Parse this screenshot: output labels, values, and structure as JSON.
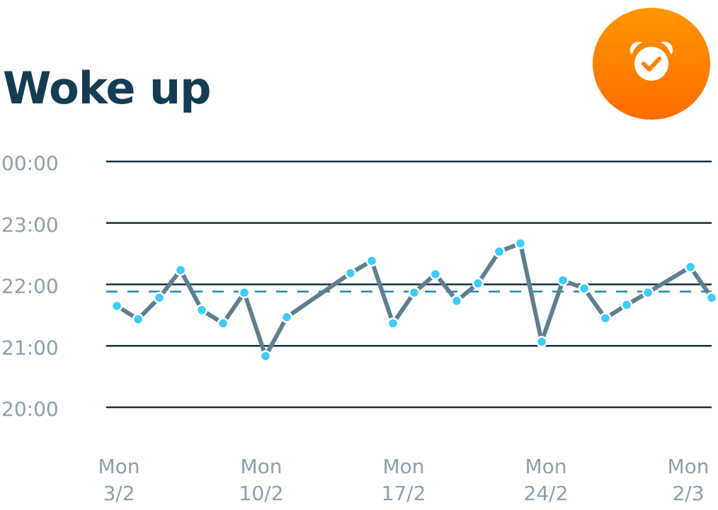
{
  "title": "Woke up",
  "icon": "alarm-clock-check-icon",
  "colors": {
    "title": "#143d52",
    "line": "#5e7f8f",
    "point": "#3ccdfa",
    "average": "#1a8aaf",
    "grid": "#143040",
    "badge_top": "#ff9500",
    "badge_bottom": "#ff6d00"
  },
  "chart_data": {
    "type": "line",
    "title": "Woke up",
    "y_ticks": [
      "00:00",
      "23:00",
      "22:00",
      "21:00",
      "20:00"
    ],
    "ylim": [
      "20:00",
      "24:00"
    ],
    "x_ticks": [
      [
        "Mon",
        "3/2"
      ],
      [
        "Mon",
        "10/2"
      ],
      [
        "Mon",
        "17/2"
      ],
      [
        "Mon",
        "24/2"
      ],
      [
        "Mon",
        "2/3"
      ]
    ],
    "xlim": [
      "3/2",
      "2/3"
    ],
    "grid": true,
    "average": "21:53",
    "points": [
      {
        "x": "3/2",
        "y": "21:39"
      },
      {
        "x": "4/2",
        "y": "21:26"
      },
      {
        "x": "5/2",
        "y": "21:47"
      },
      {
        "x": "6/2",
        "y": "22:14"
      },
      {
        "x": "7/2",
        "y": "21:35"
      },
      {
        "x": "8/2",
        "y": "21:22"
      },
      {
        "x": "9/2",
        "y": "21:52"
      },
      {
        "x": "10/2",
        "y": "20:50"
      },
      {
        "x": "11/2",
        "y": "21:28"
      },
      {
        "x": "14/2",
        "y": "22:11"
      },
      {
        "x": "15/2",
        "y": "22:23"
      },
      {
        "x": "16/2",
        "y": "21:22"
      },
      {
        "x": "17/2",
        "y": "21:52"
      },
      {
        "x": "18/2",
        "y": "22:10"
      },
      {
        "x": "19/2",
        "y": "21:44"
      },
      {
        "x": "20/2",
        "y": "22:01"
      },
      {
        "x": "21/2",
        "y": "22:32"
      },
      {
        "x": "22/2",
        "y": "22:40"
      },
      {
        "x": "23/2",
        "y": "21:04"
      },
      {
        "x": "24/2",
        "y": "22:04"
      },
      {
        "x": "25/2",
        "y": "21:56"
      },
      {
        "x": "26/2",
        "y": "21:27"
      },
      {
        "x": "27/2",
        "y": "21:40"
      },
      {
        "x": "28/2",
        "y": "21:52"
      },
      {
        "x": "1/3",
        "y": "22:17"
      },
      {
        "x": "2/3",
        "y": "21:47"
      }
    ]
  }
}
